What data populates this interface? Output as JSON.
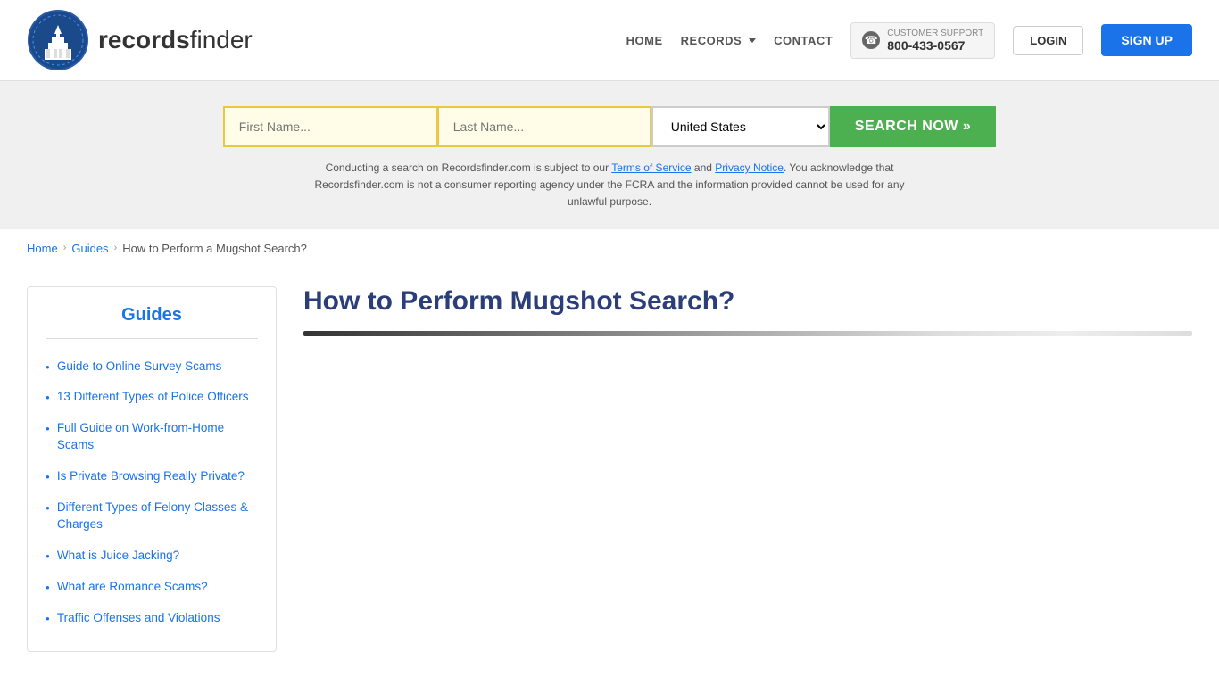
{
  "header": {
    "logo_text_light": "records",
    "logo_text_bold": "finder",
    "nav": {
      "home_label": "HOME",
      "records_label": "RECORDS",
      "contact_label": "CONTACT"
    },
    "support": {
      "label": "CUSTOMER SUPPORT",
      "phone": "800-433-0567"
    },
    "login_label": "LOGIN",
    "signup_label": "SIGN UP"
  },
  "search": {
    "first_name_placeholder": "First Name...",
    "last_name_placeholder": "Last Name...",
    "country_default": "United States",
    "button_label": "SEARCH NOW »",
    "disclaimer": "Conducting a search on Recordsfinder.com is subject to our Terms of Service and Privacy Notice. You acknowledge that Recordsfinder.com is not a consumer reporting agency under the FCRA and the information provided cannot be used for any unlawful purpose.",
    "terms_label": "Terms of Service",
    "privacy_label": "Privacy Notice"
  },
  "breadcrumb": {
    "home_label": "Home",
    "guides_label": "Guides",
    "current_label": "How to Perform a Mugshot Search?"
  },
  "sidebar": {
    "title": "Guides",
    "links": [
      {
        "label": "Guide to Online Survey Scams"
      },
      {
        "label": "13 Different Types of Police Officers"
      },
      {
        "label": "Full Guide on Work-from-Home Scams"
      },
      {
        "label": "Is Private Browsing Really Private?"
      },
      {
        "label": "Different Types of Felony Classes & Charges"
      },
      {
        "label": "What is Juice Jacking?"
      },
      {
        "label": "What are Romance Scams?"
      },
      {
        "label": "Traffic Offenses and Violations"
      }
    ]
  },
  "article": {
    "title": "How to Perform Mugshot Search?"
  }
}
